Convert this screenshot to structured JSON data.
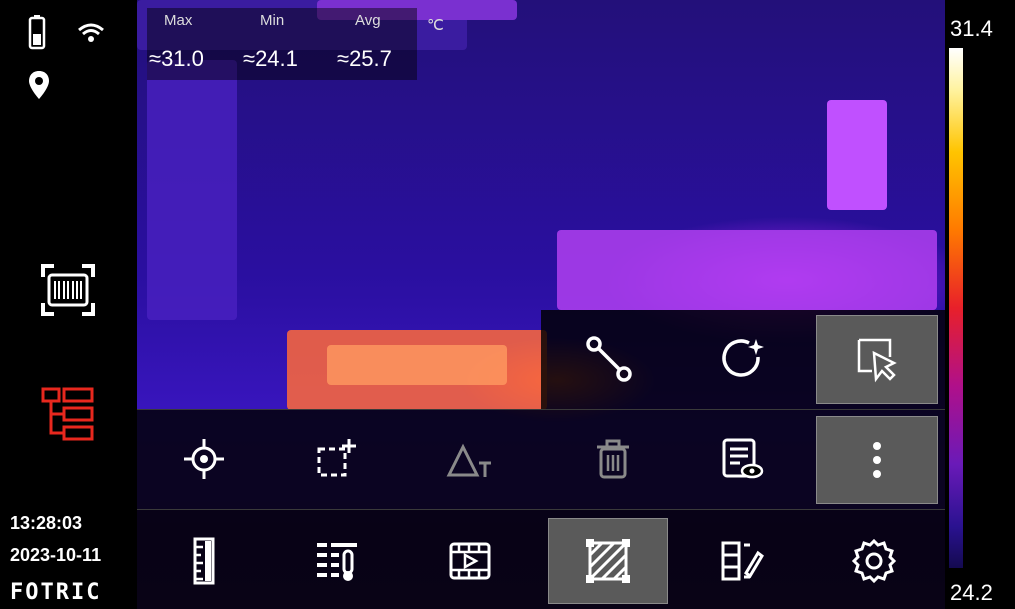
{
  "status": {
    "icons": [
      "battery-icon",
      "wifi-icon",
      "location-icon",
      "barcode-scan-icon",
      "tree-list-icon"
    ],
    "time": "13:28:03",
    "date": "2023-10-11",
    "brand": "FOTRIC"
  },
  "readout": {
    "max_label": "Max",
    "max_value": "≈31.0",
    "min_label": "Min",
    "min_value": "≈24.1",
    "avg_label": "Avg",
    "avg_value": "≈25.7",
    "unit": "℃"
  },
  "scale": {
    "top": "31.4",
    "bottom": "24.2"
  },
  "colors": {
    "accent_red": "#e8281e",
    "selected_bg": "#5a5a5a"
  },
  "menu": {
    "row1": [
      "line-tool-icon",
      "circle-add-icon",
      "select-pointer-icon"
    ],
    "row2": [
      "spot-crosshair-icon",
      "add-rectangle-icon",
      "delta-t-icon",
      "trash-icon",
      "report-view-icon",
      "more-vertical-icon"
    ],
    "row3": [
      "ruler-icon",
      "temperature-table-icon",
      "video-icon",
      "area-hatch-icon",
      "edit-compare-icon",
      "settings-gear-icon"
    ]
  }
}
